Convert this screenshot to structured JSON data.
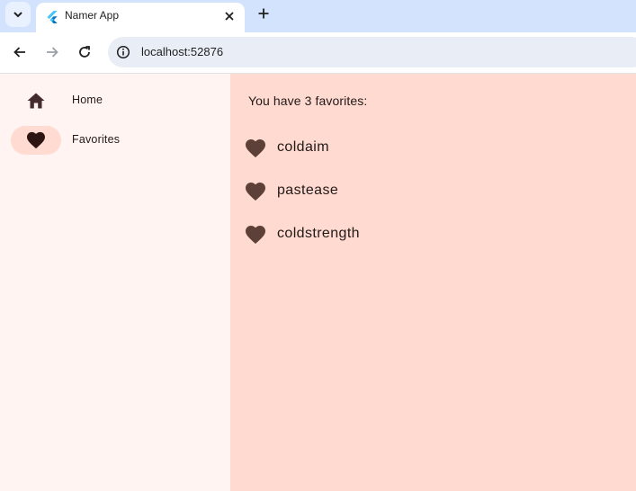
{
  "browser": {
    "tab": {
      "title": "Namer App"
    },
    "address": {
      "url": "localhost:52876"
    }
  },
  "nav": {
    "destinations": [
      {
        "label": "Home",
        "icon": "home-icon",
        "selected": false
      },
      {
        "label": "Favorites",
        "icon": "heart-icon",
        "selected": true
      }
    ]
  },
  "favorites": {
    "summary": "You have 3 favorites:",
    "items": [
      "coldaim",
      "pastease",
      "coldstrength"
    ]
  },
  "colors": {
    "tabstrip": "#d3e3fd",
    "rail_background": "#fff4f2",
    "content_background": "#ffdad1",
    "selected_indicator": "#ffdbd1",
    "heart": "#5d4037"
  }
}
